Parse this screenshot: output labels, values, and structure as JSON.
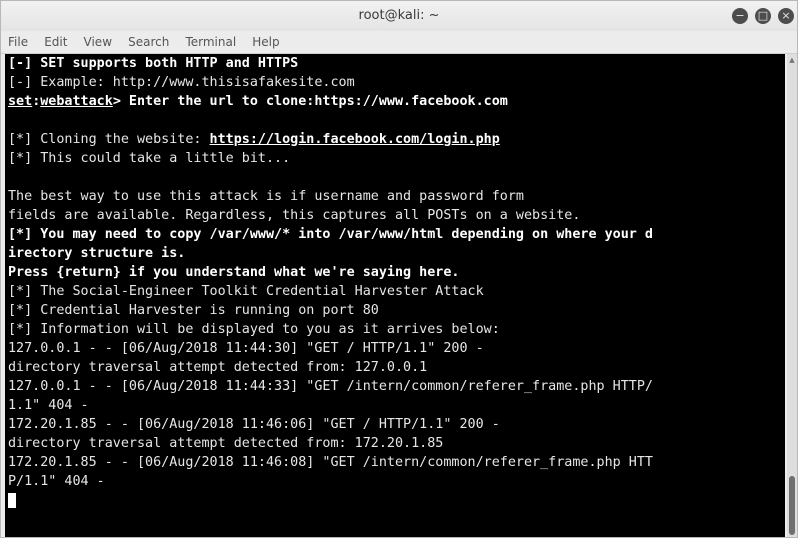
{
  "window": {
    "title": "root@kali: ~",
    "controls": [
      "minimize-icon",
      "maximize-icon",
      "close-icon"
    ],
    "control_glyphs": {
      "minimize": "−",
      "maximize": "□",
      "close": "×"
    }
  },
  "menu": {
    "items": [
      "File",
      "Edit",
      "View",
      "Search",
      "Terminal",
      "Help"
    ]
  },
  "terminal": {
    "colors": {
      "background": "#000000",
      "text": "#e6e6e6",
      "bold": "#ffffff"
    },
    "lines": [
      "[-] SET supports both HTTP and HTTPS",
      "[-] Example: http://www.thisisafakesite.com",
      {
        "prompt_a": "set",
        "prompt_sep": ":",
        "prompt_b": "webattack",
        "rest": "> Enter the url to clone:https://www.facebook.com"
      },
      "",
      {
        "prefix": "[*] Cloning the website: ",
        "url": "https://login.facebook.com/login.php"
      },
      "[*] This could take a little bit...",
      "",
      "The best way to use this attack is if username and password form",
      "fields are available. Regardless, this captures all POSTs on a website.",
      "[*] You may need to copy /var/www/* into /var/www/html depending on where your d",
      "irectory structure is.",
      "Press {return} if you understand what we're saying here.",
      "[*] The Social-Engineer Toolkit Credential Harvester Attack",
      "[*] Credential Harvester is running on port 80",
      "[*] Information will be displayed to you as it arrives below:",
      "127.0.0.1 - - [06/Aug/2018 11:44:30] \"GET / HTTP/1.1\" 200 -",
      "directory traversal attempt detected from: 127.0.0.1",
      "127.0.0.1 - - [06/Aug/2018 11:44:33] \"GET /intern/common/referer_frame.php HTTP/",
      "1.1\" 404 -",
      "172.20.1.85 - - [06/Aug/2018 11:46:06] \"GET / HTTP/1.1\" 200 -",
      "directory traversal attempt detected from: 172.20.1.85",
      "172.20.1.85 - - [06/Aug/2018 11:46:08] \"GET /intern/common/referer_frame.php HTT",
      "P/1.1\" 404 -"
    ]
  }
}
